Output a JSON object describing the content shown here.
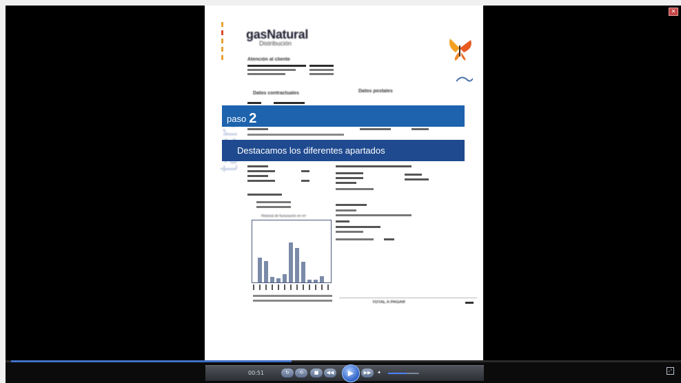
{
  "document": {
    "vertical_text": "tacra",
    "logo_title": "gasNatural",
    "logo_subtitle": "Distribución",
    "customer_section": "Atención al cliente",
    "contract_section": "Datos contractuales",
    "postal_section": "Datos postales",
    "chart_title": "Historial de facturación en m³",
    "total_label": "TOTAL A PAGAR"
  },
  "overlay": {
    "step_prefix": "paso",
    "step_number": "2",
    "message": "Destacamos los diferentes apartados"
  },
  "player": {
    "current_time": "00:51",
    "progress": 0.42,
    "volume": 0.6
  },
  "icons": {
    "close": "close-icon",
    "play": "play-icon",
    "stop": "stop-icon",
    "rewind": "rewind-icon",
    "forward": "fast-forward-icon",
    "volume": "volume-icon",
    "fullscreen": "fullscreen-icon"
  },
  "colors": {
    "step_band": "#1d63ad",
    "message_band": "#1f4a8f",
    "seek": "#3f70c6"
  }
}
